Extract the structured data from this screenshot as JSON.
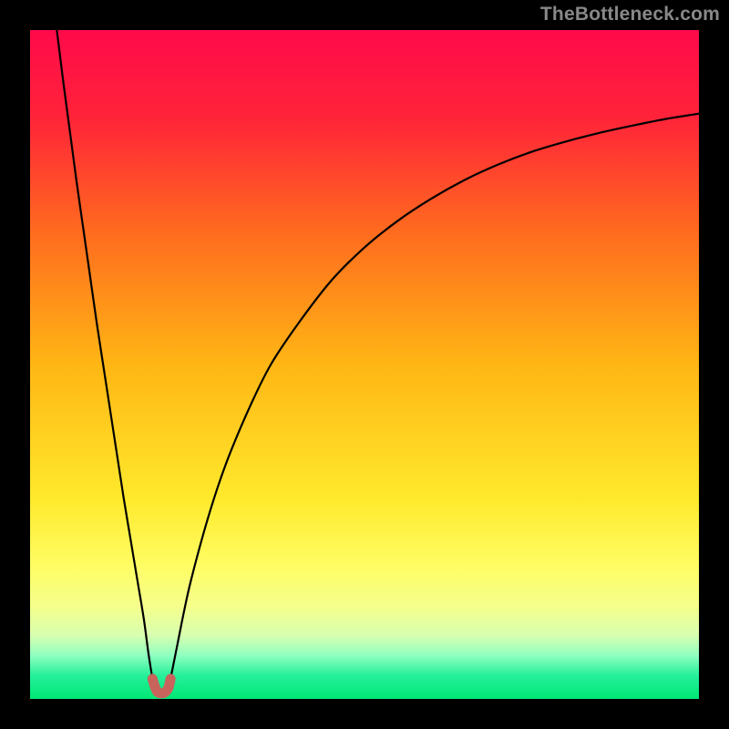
{
  "watermark": "TheBottleneck.com",
  "colors": {
    "frame": "#000000",
    "curve": "#000000",
    "marker": "#c8645c",
    "gradient_stops": [
      {
        "offset": 0.0,
        "color": "#ff0a4a"
      },
      {
        "offset": 0.13,
        "color": "#ff2339"
      },
      {
        "offset": 0.3,
        "color": "#ff6a1f"
      },
      {
        "offset": 0.5,
        "color": "#ffb614"
      },
      {
        "offset": 0.7,
        "color": "#ffe92c"
      },
      {
        "offset": 0.8,
        "color": "#fffd63"
      },
      {
        "offset": 0.86,
        "color": "#f5ff8a"
      },
      {
        "offset": 0.905,
        "color": "#d8ffb0"
      },
      {
        "offset": 0.935,
        "color": "#8fffc0"
      },
      {
        "offset": 0.965,
        "color": "#25f09a"
      },
      {
        "offset": 1.0,
        "color": "#00e775"
      }
    ]
  },
  "chart_data": {
    "type": "line",
    "title": "",
    "xlabel": "",
    "ylabel": "",
    "xlim": [
      0,
      100
    ],
    "ylim": [
      0,
      100
    ],
    "series": [
      {
        "name": "left-branch",
        "x": [
          4,
          5,
          6,
          7,
          8,
          9,
          10,
          11,
          12,
          13,
          14,
          15,
          16,
          17,
          17.7,
          18.3
        ],
        "y": [
          100,
          92,
          84.5,
          77,
          70,
          63,
          56,
          49.5,
          43,
          36.5,
          30,
          24,
          18,
          12,
          6.8,
          3.0
        ]
      },
      {
        "name": "right-branch",
        "x": [
          21,
          22,
          23,
          24,
          26,
          28,
          30,
          33,
          36,
          40,
          45,
          50,
          55,
          60,
          65,
          70,
          75,
          80,
          85,
          90,
          95,
          100
        ],
        "y": [
          3.0,
          8,
          13,
          17.5,
          25,
          31.5,
          37,
          44,
          50,
          56,
          62.5,
          67.5,
          71.5,
          74.8,
          77.6,
          79.9,
          81.8,
          83.3,
          84.6,
          85.7,
          86.7,
          87.5
        ]
      },
      {
        "name": "bottom-marker",
        "x": [
          18.3,
          18.7,
          19.0,
          19.3,
          19.7,
          20.0,
          20.3,
          20.7,
          21.0
        ],
        "y": [
          3.0,
          1.7,
          1.1,
          0.9,
          0.85,
          0.9,
          1.1,
          1.7,
          3.0
        ]
      }
    ]
  }
}
